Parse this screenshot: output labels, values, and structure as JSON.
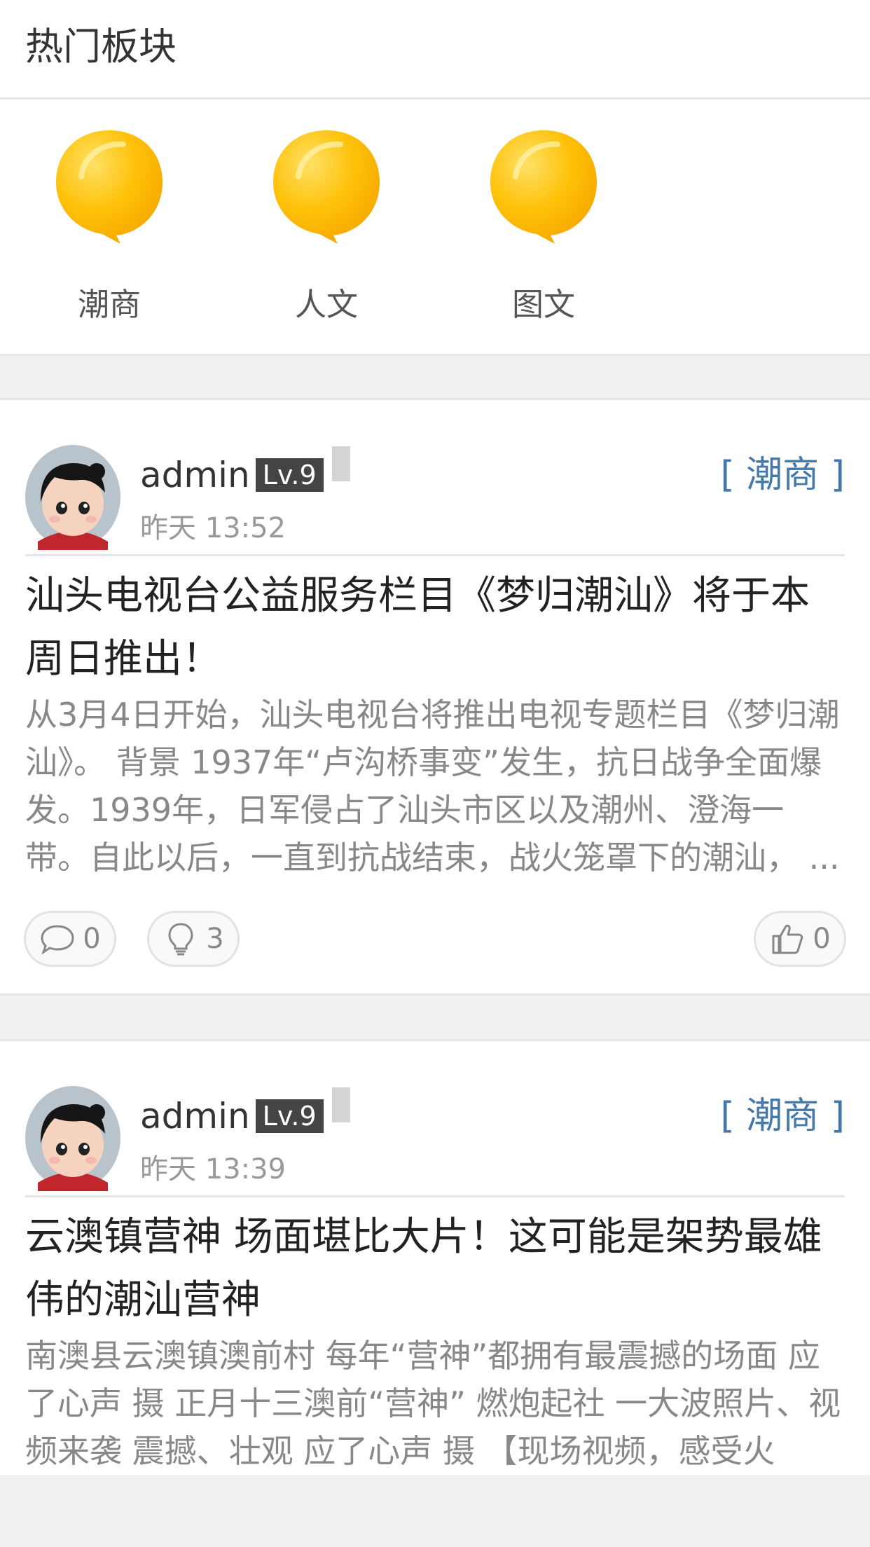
{
  "hot_section": {
    "title": "热门板块",
    "boards": [
      {
        "label": "潮商"
      },
      {
        "label": "人文"
      },
      {
        "label": "图文"
      }
    ]
  },
  "posts": [
    {
      "author": "admin",
      "level": "Lv.9",
      "time": "昨天 13:52",
      "category": "[ 潮商 ]",
      "title": "汕头电视台公益服务栏目《梦归潮汕》将于本周日推出！",
      "excerpt": "从3月4日开始，汕头电视台将推出电视专题栏目《梦归潮汕》。 背景 1937年“卢沟桥事变”发生，抗日战争全面爆发。1939年，日军侵占了汕头市区以及潮州、澄海一带。自此以后，一直到抗战结束，战火笼罩下的潮汕， ...",
      "comments": "0",
      "ideas": "3",
      "likes": "0"
    },
    {
      "author": "admin",
      "level": "Lv.9",
      "time": "昨天 13:39",
      "category": "[ 潮商 ]",
      "title": "云澳镇营神 场面堪比大片！这可能是架势最雄伟的潮汕营神",
      "excerpt": "南澳县云澳镇澳前村 每年“营神”都拥有最震撼的场面 应了心声 摄 正月十三澳前“营神” 燃炮起社 一大波照片、视频来袭 震撼、壮观 应了心声 摄 【现场视频，感受火"
    }
  ],
  "colors": {
    "accent": "#4477aa",
    "bubble": "#ffc107",
    "level_badge": "#444444"
  }
}
